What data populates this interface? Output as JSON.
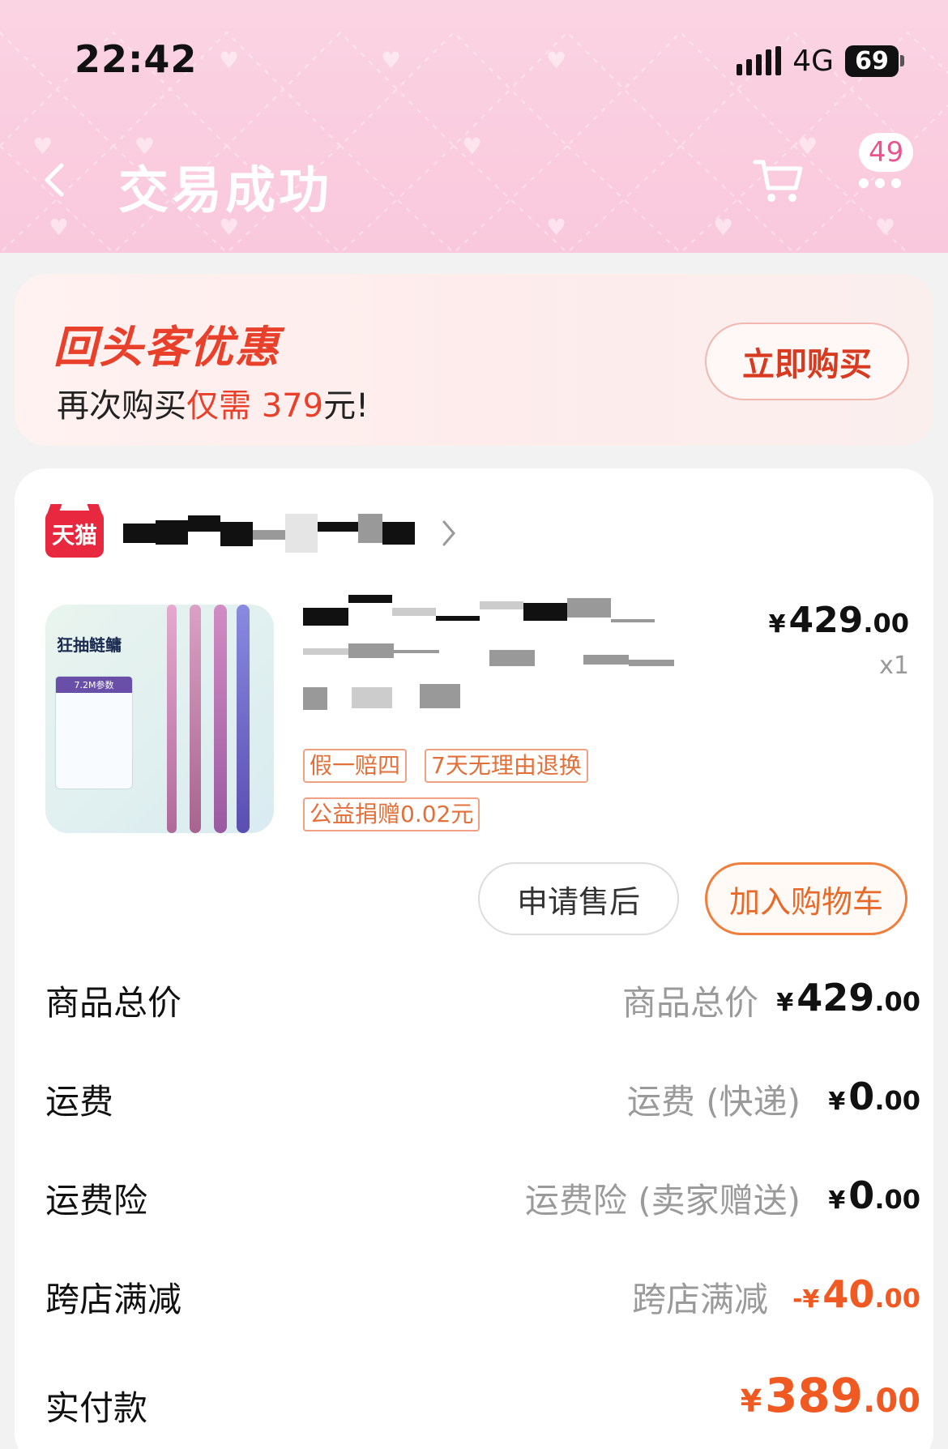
{
  "status_bar": {
    "time": "22:42",
    "network": "4G",
    "battery": "69"
  },
  "header": {
    "title": "交易成功",
    "more_badge": "49"
  },
  "promo": {
    "title": "回头客优惠",
    "desc_prefix": "再次购买",
    "desc_highlight": "仅需 379",
    "desc_suffix": "元!",
    "button": "立即购买"
  },
  "store": {
    "badge": "天猫"
  },
  "product": {
    "image_title": "狂抽鲢鳙",
    "image_panel_label": "7.2M参数",
    "price_yen": "¥",
    "price_int": "429",
    "price_cents": ".00",
    "quantity": "x1",
    "tags": [
      "假一赔四",
      "7天无理由退换",
      "公益捐赠0.02元"
    ]
  },
  "actions": {
    "after_sale": "申请售后",
    "add_to_cart": "加入购物车"
  },
  "summary": [
    {
      "label": "商品总价",
      "sub": "商品总价",
      "yen": "¥",
      "int": "429",
      "cents": ".00"
    },
    {
      "label": "运费",
      "sub": "运费 (快递)",
      "yen": "¥",
      "int": "0",
      "cents": ".00"
    },
    {
      "label": "运费险",
      "sub": "运费险 (卖家赠送)",
      "yen": "¥",
      "int": "0",
      "cents": ".00"
    },
    {
      "label": "跨店满减",
      "sub": "跨店满减",
      "yen": "-¥",
      "int": "40",
      "cents": ".00"
    }
  ],
  "total": {
    "label": "实付款",
    "yen": "¥",
    "int": "389",
    "cents": ".00"
  },
  "colors": {
    "accent_red": "#e8402a",
    "accent_orange": "#f05a22",
    "header_pink": "#fbd4e3"
  }
}
